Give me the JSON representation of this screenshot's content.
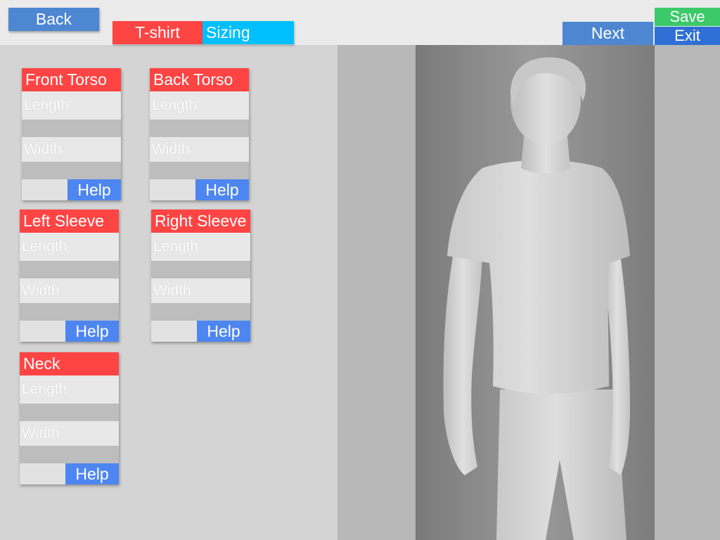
{
  "header": {
    "back_label": "Back",
    "next_label": "Next",
    "save_label": "Save",
    "exit_label": "Exit",
    "breadcrumb": {
      "garment": "T-shirt",
      "step": "Sizing"
    }
  },
  "panels": [
    {
      "title": "Front Torso",
      "length_placeholder": "Length",
      "width_placeholder": "Width",
      "help_label": "Help"
    },
    {
      "title": "Back Torso",
      "length_placeholder": "Length",
      "width_placeholder": "Width",
      "help_label": "Help"
    },
    {
      "title": "Left Sleeve",
      "length_placeholder": "Length",
      "width_placeholder": "Width",
      "help_label": "Help"
    },
    {
      "title": "Right Sleeve",
      "length_placeholder": "Length",
      "width_placeholder": "Width",
      "help_label": "Help"
    },
    {
      "title": "Neck",
      "length_placeholder": "Length",
      "width_placeholder": "Width",
      "help_label": "Help"
    }
  ],
  "colors": {
    "panel_header": "#ff4444",
    "help_button": "#4d86f0",
    "save_button": "#3cc96a",
    "exit_button": "#2f6fd6",
    "breadcrumb_step": "#00bfff"
  }
}
